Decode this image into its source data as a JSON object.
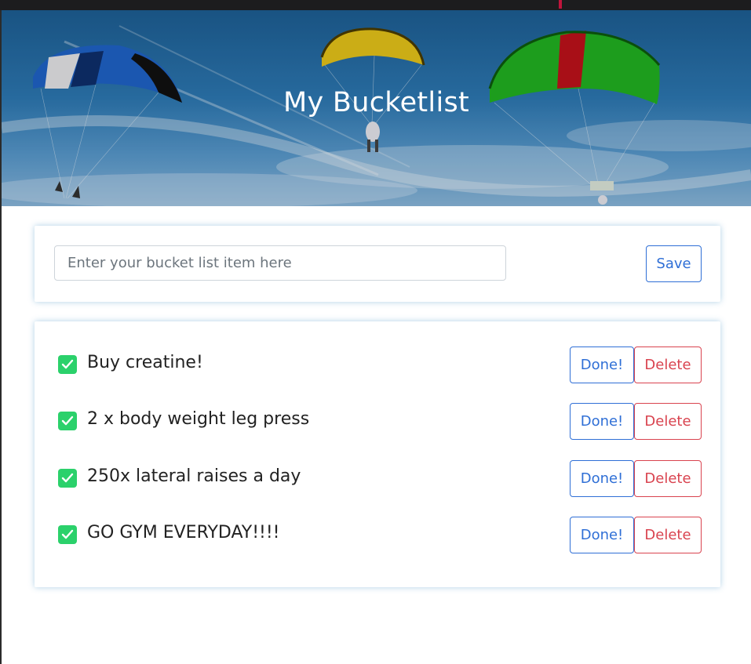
{
  "header": {
    "title": "My Bucketlist"
  },
  "form": {
    "placeholder": "Enter your bucket list item here",
    "value": "",
    "save_label": "Save"
  },
  "list": {
    "done_label": "Done!",
    "delete_label": "Delete",
    "items": [
      {
        "text": "Buy creatine!",
        "checked": true
      },
      {
        "text": "2 x body weight leg press",
        "checked": true
      },
      {
        "text": "250x lateral raises a day",
        "checked": true
      },
      {
        "text": "GO GYM EVERYDAY!!!!",
        "checked": true
      }
    ]
  },
  "colors": {
    "primary": "#2f6fd6",
    "danger": "#d9434f",
    "check": "#2bd16b",
    "hero_sky": "#2d79b4"
  },
  "icons": {
    "check": "checkbox-check-icon"
  }
}
